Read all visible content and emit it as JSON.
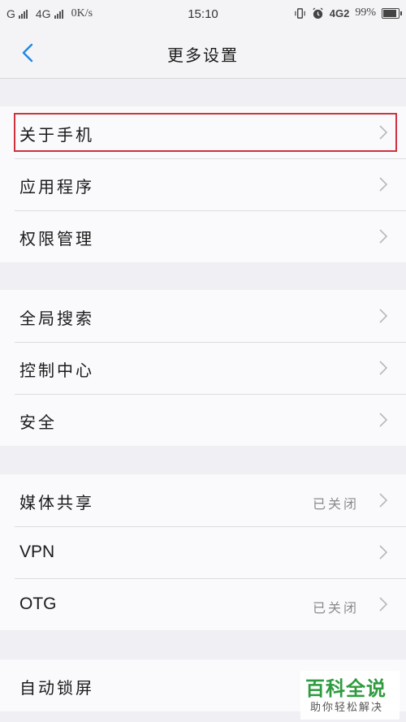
{
  "status_bar": {
    "carrier1": "G",
    "carrier2": "4G",
    "speed": "0K/s",
    "time": "15:10",
    "network": "4G2",
    "battery_pct": "99%",
    "battery_level": 0.99
  },
  "header": {
    "title": "更多设置",
    "back_icon": "chevron-left-icon"
  },
  "groups": [
    {
      "items": [
        {
          "label": "关于手机",
          "value": "",
          "highlighted": true
        },
        {
          "label": "应用程序",
          "value": ""
        },
        {
          "label": "权限管理",
          "value": ""
        }
      ]
    },
    {
      "items": [
        {
          "label": "全局搜索",
          "value": ""
        },
        {
          "label": "控制中心",
          "value": ""
        },
        {
          "label": "安全",
          "value": ""
        }
      ]
    },
    {
      "items": [
        {
          "label": "媒体共享",
          "value": "已关闭"
        },
        {
          "label": "VPN",
          "value": ""
        },
        {
          "label": "OTG",
          "value": "已关闭"
        }
      ]
    },
    {
      "items": [
        {
          "label": "自动锁屏",
          "value": ""
        }
      ]
    }
  ],
  "colors": {
    "accent": "#1e88e5",
    "highlight_border": "#d0313d",
    "watermark_green": "#2e9b3e"
  },
  "watermark": {
    "title": "百科全说",
    "subtitle": "助你轻松解决"
  }
}
